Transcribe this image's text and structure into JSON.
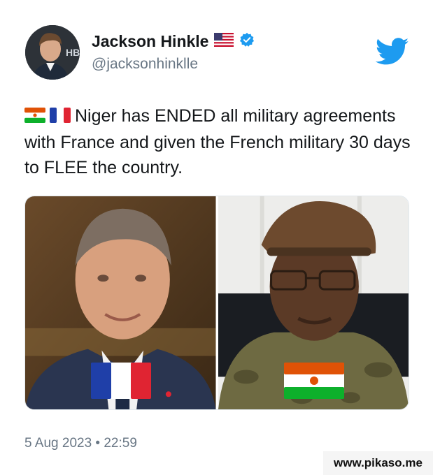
{
  "author": {
    "display_name": "Jackson Hinkle",
    "handle": "@jacksonhinklle",
    "flag_icon": "us-flag-emoji",
    "verified_icon": "verified-badge-icon"
  },
  "tweet": {
    "text": "Niger has ENDED all military agreements with France and given the French military 30 days to FLEE the country.",
    "leading_emoji": [
      "niger-flag-emoji",
      "france-flag-emoji"
    ]
  },
  "media": {
    "left_image": {
      "subject": "macron-portrait",
      "flag": "france-flag-icon"
    },
    "right_image": {
      "subject": "niger-officer-portrait",
      "flag": "niger-flag-icon"
    }
  },
  "meta": {
    "timestamp": "5 Aug 2023 • 22:59",
    "watermark": "www.pikaso.me"
  },
  "colors": {
    "twitter_blue": "#1d9bf0",
    "secondary_text": "#687684"
  }
}
